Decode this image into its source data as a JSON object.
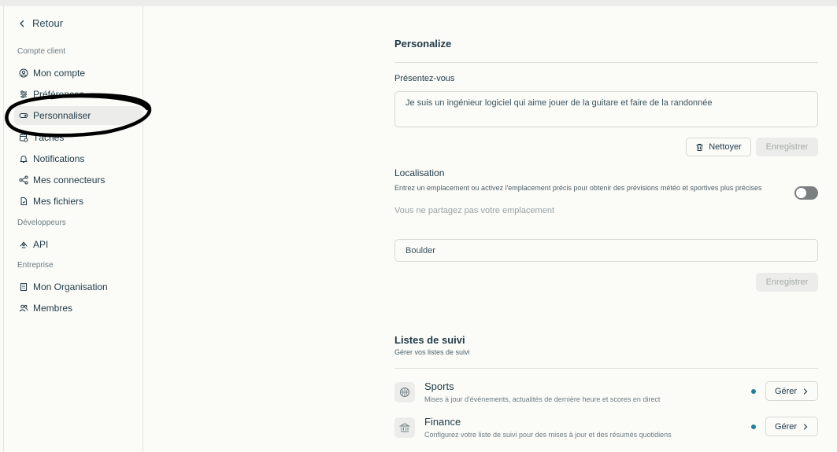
{
  "sidebar": {
    "back_label": "Retour",
    "sections": {
      "client": "Compte client",
      "dev": "Développeurs",
      "enterprise": "Entreprise"
    },
    "items": {
      "account": "Mon compte",
      "preferences": "Préférences",
      "personalize": "Personnaliser",
      "tasks": "Tâches",
      "notifications": "Notifications",
      "connectors": "Mes connecteurs",
      "files": "Mes fichiers",
      "api": "API",
      "organisation": "Mon Organisation",
      "members": "Membres"
    },
    "active_item": "Personnaliser"
  },
  "main": {
    "title": "Personalize",
    "intro": {
      "label": "Présentez-vous",
      "value": "Je suis un ingénieur logiciel qui aime jouer de la guitare et faire de la randonnée",
      "clear_label": "Nettoyer",
      "save_label": "Enregistrer"
    },
    "location": {
      "label": "Localisation",
      "description": "Entrez un emplacement ou activez l'emplacement précis pour obtenir des prévisions météo et sportives plus précises",
      "status": "Vous ne partagez pas votre emplacement",
      "toggle_on": false,
      "value": "Boulder",
      "save_label": "Enregistrer"
    },
    "watchlists": {
      "title": "Listes de suivi",
      "subtitle": "Gérer vos listes de suivi",
      "items": [
        {
          "name": "Sports",
          "description": "Mises à jour d'événements, actualités de dernière heure et scores en direct",
          "manage_label": "Gérer",
          "icon": "basketball-icon"
        },
        {
          "name": "Finance",
          "description": "Configurez votre liste de suivi pour des mises à jour et des résumés quotidiens",
          "manage_label": "Gérer",
          "icon": "bank-icon"
        }
      ]
    }
  },
  "colors": {
    "background": "#fbfbf8",
    "text": "#1f3a46",
    "accent_dot": "#1f7f9a",
    "disabled_button": "#ececea"
  }
}
